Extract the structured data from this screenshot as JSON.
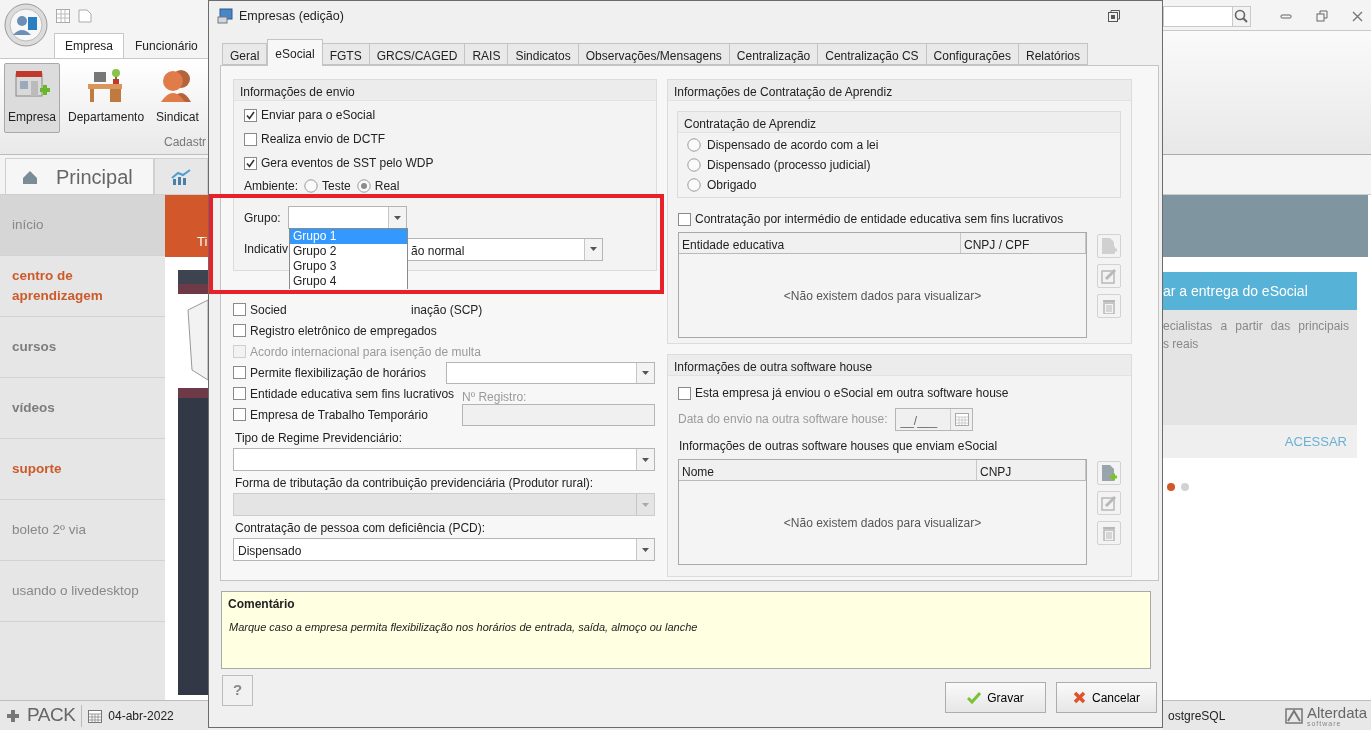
{
  "app": {
    "ribbon_tabs": [
      {
        "label": "Empresa",
        "selected": true
      },
      {
        "label": "Funcionário",
        "selected": false
      }
    ],
    "ribbon_buttons": [
      {
        "label": "Empresa",
        "kind": "company",
        "selected": true
      },
      {
        "label": "Departamento",
        "kind": "desk",
        "selected": false
      },
      {
        "label": "Sindicat",
        "kind": "people",
        "selected": false
      }
    ],
    "ribbon_group": "Cadastr",
    "view_tabs": [
      {
        "kind": "home",
        "label": "Principal",
        "selected": true
      },
      {
        "kind": "chart",
        "selected": false
      }
    ],
    "sidebar": [
      {
        "label": "início",
        "kind": "plain",
        "selected": true
      },
      {
        "label": "centro de aprendizagem",
        "kind": "accent",
        "selected": false
      },
      {
        "label": "cursos",
        "kind": "bold",
        "selected": false
      },
      {
        "label": "vídeos",
        "kind": "bold",
        "selected": false
      },
      {
        "label": "suporte",
        "kind": "accent",
        "selected": false
      },
      {
        "label": "boleto 2º via",
        "kind": "plain",
        "selected": false
      },
      {
        "label": "usando o livedesktop",
        "kind": "plain",
        "selected": false
      }
    ],
    "banner_label": "Ti",
    "promo": {
      "title": "ar a entrega do eSocial",
      "lines": [
        "ecialistas a partir das principais",
        "s reais"
      ],
      "link": "ACESSAR"
    },
    "carousel_dots": [
      {
        "selected": true
      },
      {
        "selected": false
      }
    ],
    "status_bar": {
      "brand": "PACK",
      "date": "04-abr-2022",
      "database": "ostgreSQL",
      "vendor": "Alterdata",
      "vendor_sub": "software"
    }
  },
  "dialog": {
    "title": "Empresas (edição)",
    "tabs": [
      {
        "label": "Geral",
        "selected": false
      },
      {
        "label": "eSocial",
        "selected": true
      },
      {
        "label": "FGTS",
        "selected": false
      },
      {
        "label": "GRCS/CAGED",
        "selected": false
      },
      {
        "label": "RAIS",
        "selected": false
      },
      {
        "label": "Sindicatos",
        "selected": false
      },
      {
        "label": "Observações/Mensagens",
        "selected": false
      },
      {
        "label": "Centralização",
        "selected": false
      },
      {
        "label": "Centralização CS",
        "selected": false
      },
      {
        "label": "Configurações",
        "selected": false
      },
      {
        "label": "Relatórios",
        "selected": false
      }
    ],
    "send_info": {
      "title": "Informações de envio",
      "checks": [
        {
          "label": "Enviar para o eSocial",
          "checked": true
        },
        {
          "label": "Realiza envio de DCTF",
          "checked": false
        },
        {
          "label": "Gera eventos de SST pelo WDP",
          "checked": true
        }
      ],
      "environment": {
        "label": "Ambiente:",
        "options": [
          {
            "label": "Teste",
            "selected": false
          },
          {
            "label": "Real",
            "selected": true
          }
        ]
      },
      "group": {
        "label": "Grupo:",
        "options": [
          {
            "label": "Grupo 1",
            "selected": true
          },
          {
            "label": "Grupo 2",
            "selected": false
          },
          {
            "label": "Grupo 3",
            "selected": false
          },
          {
            "label": "Grupo 4",
            "selected": false
          }
        ]
      },
      "indicator": {
        "label": "Indicativ",
        "value": "ão normal"
      }
    },
    "scp": {
      "label": "Socied",
      "label_end": "inação (SCP)",
      "checked": false
    },
    "flags": [
      {
        "label": "Registro eletrônico de empregados",
        "checked": false,
        "disabled": false,
        "kind": "plain"
      },
      {
        "label": "Acordo internacional para isenção de multa",
        "checked": false,
        "disabled": true,
        "kind": "plain"
      },
      {
        "label": "Permite flexibilização de horários",
        "checked": false,
        "disabled": false,
        "kind": "combo"
      },
      {
        "label": "Entidade educativa sem fins lucrativos",
        "checked": false,
        "disabled": false,
        "kind": "label",
        "extra_label": "Nº Registro:"
      },
      {
        "label": "Empresa de Trabalho Temporário",
        "checked": false,
        "disabled": false,
        "kind": "field"
      }
    ],
    "selects": [
      {
        "label": "Tipo de Regime Previdenciário:",
        "disabled": false
      },
      {
        "label": "Forma de tributação da contribuição previdenciária (Produtor rural):",
        "disabled": true
      },
      {
        "label": "Contratação de pessoa com deficiência (PCD):",
        "value": "Dispensado",
        "disabled": false
      }
    ],
    "apprentice": {
      "title": "Informações de Contratação de Aprendiz",
      "subtitle": "Contratação de Aprendiz",
      "options": [
        {
          "label": "Dispensado de acordo com a lei",
          "selected": false
        },
        {
          "label": "Dispensado (processo judicial)",
          "selected": false
        },
        {
          "label": "Obrigado",
          "selected": false
        }
      ],
      "check": {
        "label": "Contratação por intermédio de entidade educativa sem fins lucrativos",
        "checked": false
      },
      "table": {
        "columns": [
          "Entidade educativa",
          "CNPJ / CPF"
        ],
        "empty": "<Não existem dados para visualizar>"
      },
      "actions": [
        {
          "kind": "add",
          "disabled": true
        },
        {
          "kind": "edit",
          "disabled": true
        },
        {
          "kind": "delete",
          "disabled": true
        }
      ]
    },
    "other_house": {
      "title": "Informações de outra software house",
      "check": {
        "label": "Esta empresa já enviou o eSocial em outra software house",
        "checked": false
      },
      "date": {
        "label": "Data do envio na outra software house:",
        "value": "__/___",
        "disabled": true
      },
      "list_label": "Informações de outras software houses que enviam eSocial",
      "table": {
        "columns": [
          "Nome",
          "CNPJ"
        ],
        "empty": "<Não existem dados para visualizar>"
      },
      "actions": [
        {
          "kind": "add",
          "disabled": false
        },
        {
          "kind": "edit",
          "disabled": true
        },
        {
          "kind": "delete",
          "disabled": true
        }
      ]
    },
    "comment": {
      "title": "Comentário",
      "text": "Marque caso a empresa permita flexibilização nos horários de entrada, saída, almoço ou lanche"
    },
    "help": "?",
    "buttons": [
      {
        "kind": "save",
        "label": "Gravar"
      },
      {
        "kind": "cancel",
        "label": "Cancelar"
      }
    ]
  }
}
